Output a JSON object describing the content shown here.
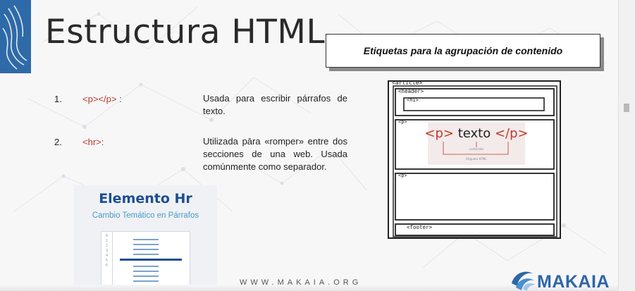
{
  "slide": {
    "title": "Estructura HTML",
    "subtitle": "Etiquetas para la agrupación de contenido"
  },
  "items": [
    {
      "number": "1.",
      "tag_open": "<p>",
      "tag_close": "</p>",
      "tag_suffix": " :",
      "description": "Usada para escribir párrafos de texto."
    },
    {
      "number": "2.",
      "tag_open": "<hr>",
      "tag_suffix": ":",
      "description": "Utilizada pāra «romper» entre dos secciones de una web. Usada comúnmente como separador."
    }
  ],
  "hr_image": {
    "title": "Elemento Hr",
    "subtitle": "Cambio Temático en Párrafos",
    "line_numbers": "0\n1\n2\n3\n4\n5\n6"
  },
  "diagram": {
    "article_label": "<article>",
    "header_label": "<header>",
    "h1_label": "<h1>",
    "p_label": "<p>",
    "p_example": "<p> texto </p>",
    "p_example_open": "<p>",
    "p_example_text": " texto ",
    "p_example_close": "</p>",
    "p_note_content": "contenido",
    "p_note_tag": "Etiqueta HTML",
    "p2_label": "<p>",
    "footer_label": "<footer>"
  },
  "footer": {
    "website": "WWW.MAKAIA.ORG",
    "brand": "MAKAIA"
  },
  "colors": {
    "title": "#2a2a2a",
    "tag_red": "#c0392b",
    "brand_blue": "#2e67a6",
    "hr_title": "#1d4f91"
  }
}
